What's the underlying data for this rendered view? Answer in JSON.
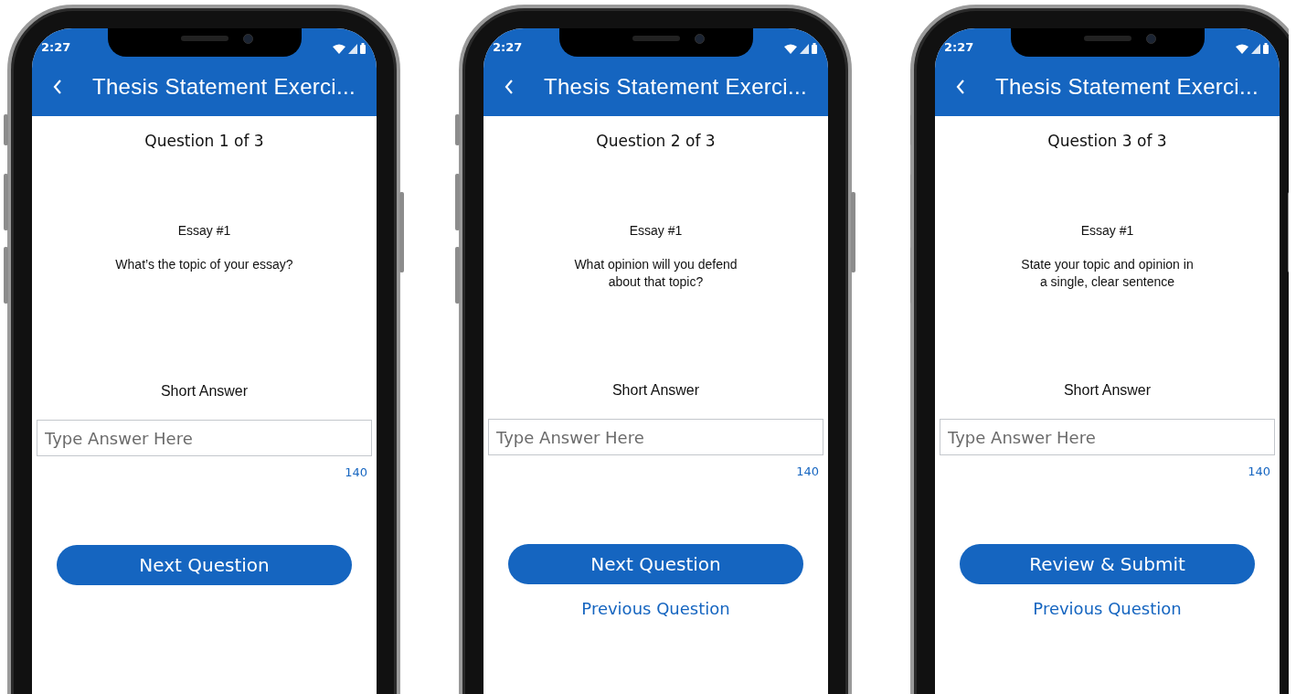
{
  "phones": [
    {
      "status_time": "2:27",
      "title": "Thesis Statement Exerci...",
      "counter": "Question 1 of 3",
      "essay": "Essay #1",
      "question": "What’s the topic of your essay?",
      "answer_label": "Short Answer",
      "answer_placeholder": "Type Answer Here",
      "char_count": "140",
      "primary_button": "Next Question"
    },
    {
      "status_time": "2:27",
      "title": "Thesis Statement Exerci...",
      "counter": "Question 2 of 3",
      "essay": "Essay #1",
      "question": "What opinion will you defend\nabout that topic?",
      "answer_label": "Short Answer",
      "answer_placeholder": "Type Answer Here",
      "char_count": "140",
      "primary_button": "Next Question",
      "secondary_link": "Previous Question"
    },
    {
      "status_time": "2:27",
      "title": "Thesis Statement Exerci...",
      "counter": "Question 3 of 3",
      "essay": "Essay #1",
      "question": "State your topic and opinion in\na single, clear sentence",
      "answer_label": "Short Answer",
      "answer_placeholder": "Type Answer Here",
      "char_count": "140",
      "primary_button": "Review & Submit",
      "secondary_link": "Previous Question"
    }
  ]
}
